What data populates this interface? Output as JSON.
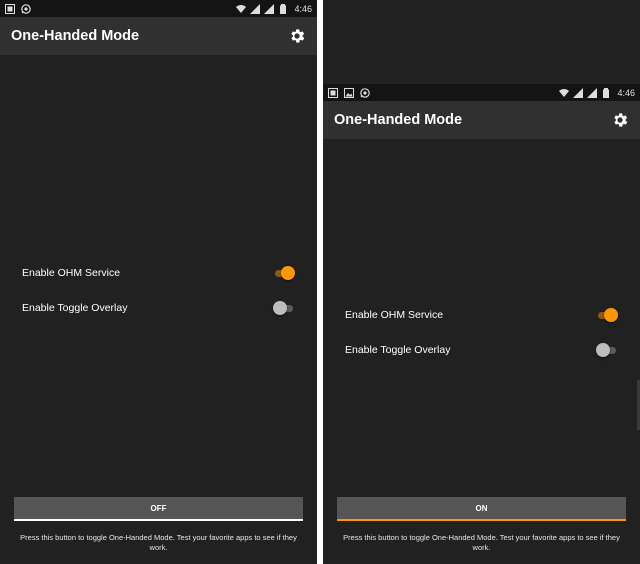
{
  "screens": [
    {
      "status_bar": {
        "left_icons": [
          "screenshot-icon",
          "whatsapp-icon"
        ],
        "right_icons": [
          "wifi-icon",
          "signal-icon",
          "signal-icon-2",
          "battery-icon"
        ],
        "time": "4:46"
      },
      "app_bar": {
        "title": "One-Handed Mode",
        "settings_icon": "gear-icon"
      },
      "settings": [
        {
          "label": "Enable OHM Service",
          "state": "on"
        },
        {
          "label": "Enable Toggle Overlay",
          "state": "off"
        }
      ],
      "toggle_button": {
        "label": "OFF"
      },
      "help_text": "Press this button to toggle One-Handed Mode. Test your favorite apps to see if they work."
    },
    {
      "status_bar": {
        "left_icons": [
          "screenshot-icon",
          "image-icon",
          "whatsapp-icon"
        ],
        "right_icons": [
          "wifi-icon",
          "signal-icon",
          "signal-icon-2",
          "battery-icon"
        ],
        "time": "4:46"
      },
      "app_bar": {
        "title": "One-Handed Mode",
        "settings_icon": "gear-icon"
      },
      "settings": [
        {
          "label": "Enable OHM Service",
          "state": "on"
        },
        {
          "label": "Enable Toggle Overlay",
          "state": "off"
        }
      ],
      "toggle_button": {
        "label": "ON"
      },
      "help_text": "Press this button to toggle One-Handed Mode. Test your favorite apps to see if they work."
    }
  ],
  "colors": {
    "background": "#212121",
    "app_bar": "#303030",
    "status_bar": "#141414",
    "accent": "#ff9800",
    "button": "#555555"
  }
}
